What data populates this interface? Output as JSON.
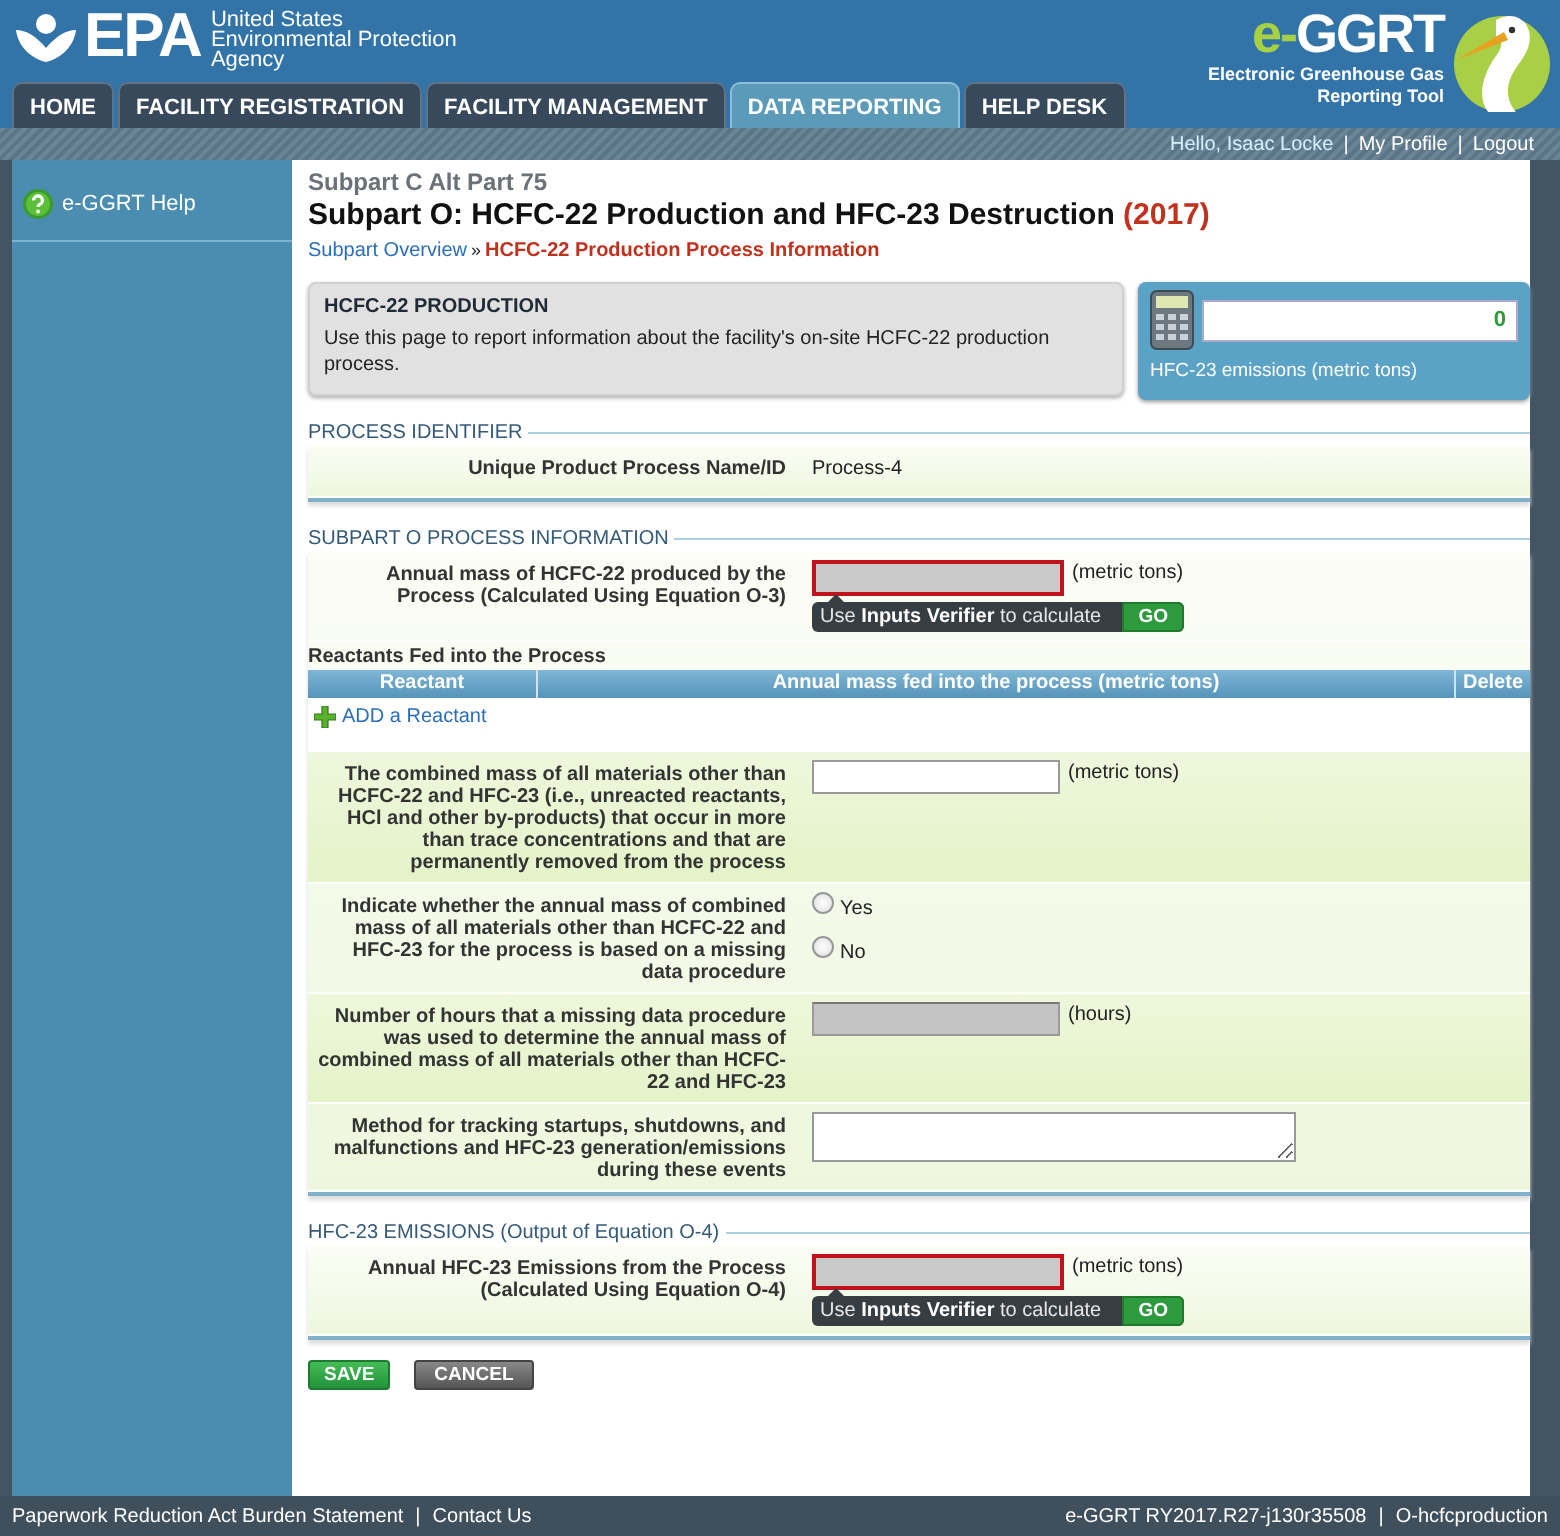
{
  "header": {
    "logo_text": "EPA",
    "agency": [
      "United States",
      "Environmental Protection",
      "Agency"
    ],
    "app_name_prefix": "e-",
    "app_name": "GGRT",
    "app_subtitle": [
      "Electronic Greenhouse Gas",
      "Reporting Tool"
    ]
  },
  "tabs": [
    {
      "label": "HOME",
      "selected": false
    },
    {
      "label": "FACILITY REGISTRATION",
      "selected": false
    },
    {
      "label": "FACILITY MANAGEMENT",
      "selected": false
    },
    {
      "label": "DATA REPORTING",
      "selected": true
    },
    {
      "label": "HELP DESK",
      "selected": false
    }
  ],
  "user_bar": [
    "Hello, Isaac Locke",
    "My Profile",
    "Logout"
  ],
  "user_bar_separator": "|",
  "sidebar": {
    "items": [
      {
        "label": "e-GGRT Help"
      }
    ]
  },
  "page": {
    "subtitle": "Subpart C Alt Part 75",
    "title": "Subpart O: HCFC-22 Production and HFC-23 Destruction",
    "year": "(2017)",
    "breadcrumb": [
      {
        "label": "Subpart Overview",
        "current": false
      },
      {
        "label": "HCFC-22 Production Process Information",
        "current": true
      }
    ],
    "breadcrumb_separator": "»"
  },
  "info_box": {
    "title": "HCFC-22 PRODUCTION",
    "text": "Use this page to report information about the facility's on-site HCFC-22 production process."
  },
  "emissions_box": {
    "value": "0",
    "label": "HFC-23 emissions (metric tons)"
  },
  "sections": [
    {
      "title": "PROCESS IDENTIFIER",
      "items": [
        {
          "kind": "value",
          "label": "Unique Product Process Name/ID",
          "value": "Process-4"
        }
      ]
    },
    {
      "title": "SUBPART O PROCESS INFORMATION",
      "items": [
        {
          "kind": "calculated",
          "label": "Annual mass of HCFC-22 produced by the Process (Calculated Using Equation O-3)",
          "unit": "(metric tons)",
          "verifier": {
            "before": "Use",
            "bold": "Inputs Verifier",
            "after": "to calculate",
            "button": "GO"
          }
        },
        {
          "kind": "table",
          "title": "Reactants Fed into the Process",
          "columns": [
            "Reactant",
            "Annual mass fed into the process (metric tons)",
            "Delete"
          ],
          "add_link": "ADD a Reactant"
        },
        {
          "kind": "input",
          "label": "The combined mass of all materials other than HCFC-22 and HFC-23 (i.e., unreacted reactants, HCl and other by-products) that occur in more than trace concentrations and that are permanently removed from the process",
          "unit": "(metric tons)"
        },
        {
          "kind": "radio",
          "label": "Indicate whether the annual mass of combined mass of all materials other than HCFC-22 and HFC-23 for the process is based on a missing data procedure",
          "options": [
            {
              "label": "Yes",
              "selected": false
            },
            {
              "label": "No",
              "selected": false
            }
          ]
        },
        {
          "kind": "disabled",
          "label": "Number of hours that a missing data procedure was used to determine the annual mass of combined mass of all materials other than HCFC-22 and HFC-23",
          "unit": "(hours)"
        },
        {
          "kind": "textarea",
          "label": "Method for tracking startups, shutdowns, and malfunctions and HFC-23 generation/emissions during these events"
        }
      ]
    },
    {
      "title": "HFC-23 EMISSIONS (Output of Equation O-4)",
      "items": [
        {
          "kind": "calculated",
          "label": "Annual HFC-23 Emissions from the Process (Calculated Using Equation O-4)",
          "unit": "(metric tons)",
          "verifier": {
            "before": "Use",
            "bold": "Inputs Verifier",
            "after": "to calculate",
            "button": "GO"
          }
        }
      ]
    }
  ],
  "buttons": [
    {
      "kind": "save",
      "label": "SAVE"
    },
    {
      "kind": "cancel",
      "label": "CANCEL"
    }
  ],
  "footer": {
    "left": [
      "Paperwork Reduction Act Burden Statement",
      "Contact Us"
    ],
    "right": [
      "e-GGRT RY2017.R27-j130r35508",
      "O-hcfcproduction"
    ],
    "separator": "|"
  }
}
